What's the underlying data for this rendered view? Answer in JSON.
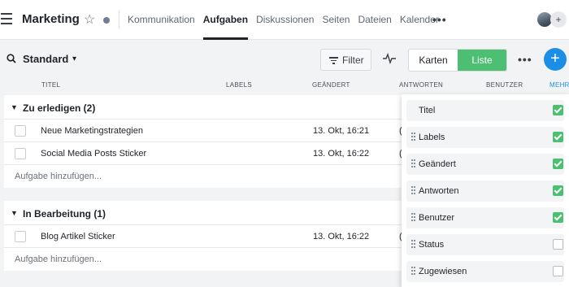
{
  "header": {
    "title": "Marketing",
    "tabs": [
      {
        "label": "Kommunikation",
        "active": false
      },
      {
        "label": "Aufgaben",
        "active": true
      },
      {
        "label": "Diskussionen",
        "active": false
      },
      {
        "label": "Seiten",
        "active": false
      },
      {
        "label": "Dateien",
        "active": false
      },
      {
        "label": "Kalender",
        "active": false
      }
    ],
    "more_label": "•••",
    "avatar_plus": "+"
  },
  "toolbar": {
    "view_name": "Standard",
    "filter_label": "Filter",
    "view_toggle": [
      {
        "label": "Karten",
        "active": false
      },
      {
        "label": "Liste",
        "active": true
      }
    ],
    "more_label": "•••",
    "add_label": "+"
  },
  "columns": [
    "TITEL",
    "LABELS",
    "GEÄNDERT",
    "ANTWORTEN",
    "BENUTZER",
    "MEHR"
  ],
  "groups": [
    {
      "title": "Zu erledigen (2)",
      "tasks": [
        {
          "title": "Neue Marketingstrategien",
          "changed": "13. Okt, 16:21",
          "cut": "("
        },
        {
          "title": "Social Media Posts Sticker",
          "changed": "13. Okt, 16:22",
          "cut": "("
        }
      ],
      "add_label": "Aufgabe hinzufügen..."
    },
    {
      "title": "In Bearbeitung (1)",
      "tasks": [
        {
          "title": "Blog Artikel Sticker",
          "changed": "13. Okt, 16:22",
          "cut": "("
        }
      ],
      "add_label": "Aufgabe hinzufügen..."
    }
  ],
  "column_picker": [
    {
      "label": "Titel",
      "checked": true,
      "draggable": false
    },
    {
      "label": "Labels",
      "checked": true,
      "draggable": true
    },
    {
      "label": "Geändert",
      "checked": true,
      "draggable": true
    },
    {
      "label": "Antworten",
      "checked": true,
      "draggable": true
    },
    {
      "label": "Benutzer",
      "checked": true,
      "draggable": true
    },
    {
      "label": "Status",
      "checked": false,
      "draggable": true
    },
    {
      "label": "Zugewiesen",
      "checked": false,
      "draggable": true
    }
  ],
  "colors": {
    "accent_green": "#4dbf73",
    "accent_blue": "#1b8fe6"
  }
}
